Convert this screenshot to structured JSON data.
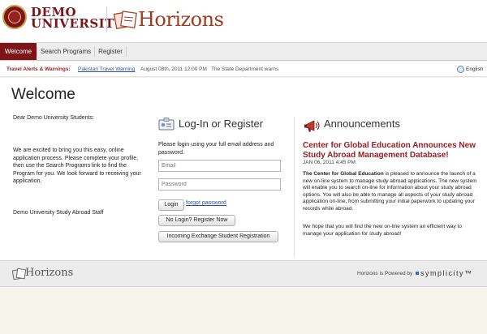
{
  "header": {
    "university_name_line1": "DEMO",
    "university_name_line2": "UNIVERSITY",
    "brand": "Horizons"
  },
  "nav": {
    "tabs": [
      {
        "label": "Welcome",
        "active": true
      },
      {
        "label": "Search Programs",
        "active": false
      },
      {
        "label": "Register",
        "active": false
      }
    ]
  },
  "alerts": {
    "label": "Travel Alerts & Warnings:",
    "link": "Pakistan Travel Warning",
    "date": "August 08th, 2011 12:00 PM",
    "message": "The State Department warns t",
    "language": "English"
  },
  "welcome": {
    "title": "Welcome",
    "greeting": "Dear Demo University Students:",
    "body": "We are excited to bring you this easy, online application process.  Please complete your profile, then use the Search Programs link to find the Program for you.  We look forward to receiving your application.",
    "signature": "Demo University Study Abroad Staff"
  },
  "login": {
    "title": "Log-In or Register",
    "description": "Please login using your full email address and password.",
    "email_placeholder": "Email",
    "password_placeholder": "Password",
    "login_button": "Login",
    "forgot_link": "forgot password",
    "register_button": "No Login? Register Now",
    "exchange_button": "Incoming Exchange Student Registration"
  },
  "announcements": {
    "title": "Announcements",
    "headline": "Center for Global Education Announces New Study Abroad Management Database!",
    "date": "JAN 06, 2011 4:45 PM",
    "body_bold": "The Center for Global Education",
    "body_rest": " is pleased to announce the launch of a new on-line system to manage study abroad applications.  The new system will enable you to search on-line for information about your study abroad options. You will also be able to manage all aspects of your study abroad application on-line, from submitting your initial paperwork to updating your records while abroad.",
    "body2": "We hope that you will find the new on-line system an efficient way to manage your application for study abroad!"
  },
  "footer": {
    "brand": "Horizons",
    "powered_by": "Horizons is Powered by",
    "vendor": "symplicity™"
  },
  "colors": {
    "brand_maroon": "#7d1418",
    "accent_red": "#9a1f23",
    "link_blue": "#2b4fa0"
  }
}
